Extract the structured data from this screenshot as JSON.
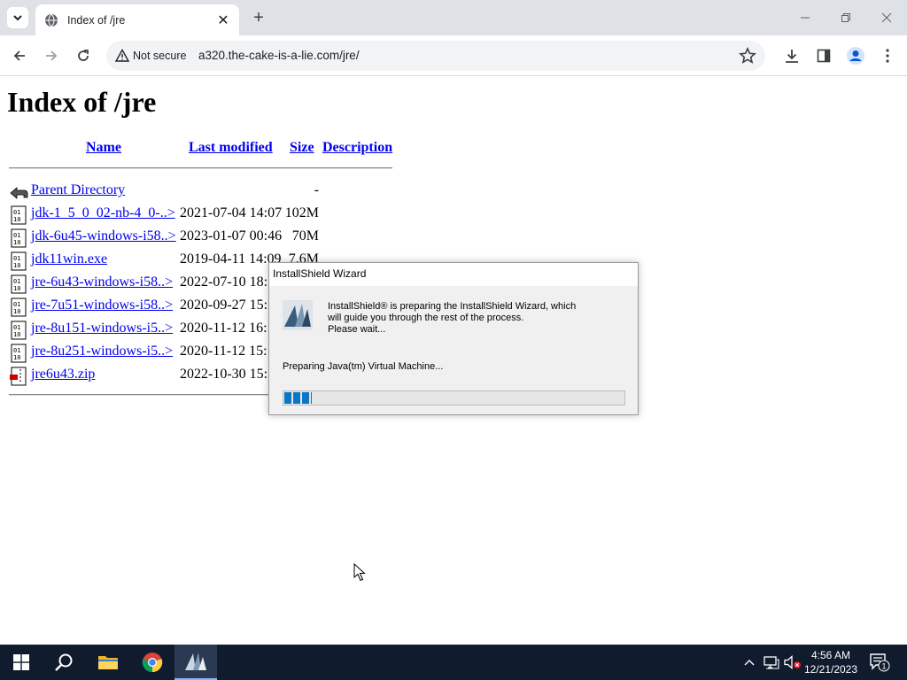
{
  "browser": {
    "tab": {
      "title": "Index of /jre"
    },
    "address": {
      "security_label": "Not secure",
      "url": "a320.the-cake-is-a-lie.com/jre/"
    }
  },
  "page": {
    "heading": "Index of /jre",
    "columns": {
      "name": "Name",
      "modified": "Last modified",
      "size": "Size",
      "description": "Description"
    },
    "parent": {
      "name": "Parent Directory",
      "size": "-"
    },
    "files": [
      {
        "name": "jdk-1_5_0_02-nb-4_0-..>",
        "modified": "2021-07-04 14:07",
        "size": "102M",
        "icon": "binary-file-icon"
      },
      {
        "name": "jdk-6u45-windows-i58..>",
        "modified": "2023-01-07 00:46",
        "size": "70M",
        "icon": "binary-file-icon"
      },
      {
        "name": "jdk11win.exe",
        "modified": "2019-04-11 14:09",
        "size": "7.6M",
        "icon": "binary-file-icon"
      },
      {
        "name": "jre-6u43-windows-i58..>",
        "modified": "2022-07-10 18:",
        "size": "",
        "icon": "binary-file-icon"
      },
      {
        "name": "jre-7u51-windows-i58..>",
        "modified": "2020-09-27 15:",
        "size": "",
        "icon": "binary-file-icon"
      },
      {
        "name": "jre-8u151-windows-i5..>",
        "modified": "2020-11-12 16:",
        "size": "",
        "icon": "binary-file-icon"
      },
      {
        "name": "jre-8u251-windows-i5..>",
        "modified": "2020-11-12 15:",
        "size": "",
        "icon": "binary-file-icon"
      },
      {
        "name": "jre6u43.zip",
        "modified": "2022-10-30 15:",
        "size": "",
        "icon": "compressed-file-icon"
      }
    ]
  },
  "dialog": {
    "title": "InstallShield Wizard",
    "message_line1": "InstallShield® is preparing the InstallShield Wizard, which",
    "message_line2": "will guide you through the rest of the process.",
    "message_line3": "Please wait...",
    "status": "Preparing Java(tm) Virtual Machine...",
    "progress_percent": 8
  },
  "taskbar": {
    "time": "4:56 AM",
    "date": "12/21/2023",
    "notification_count": "1"
  },
  "colors": {
    "link": "#0000ee",
    "taskbar": "#101b2d",
    "progress": "#0a76c6"
  }
}
